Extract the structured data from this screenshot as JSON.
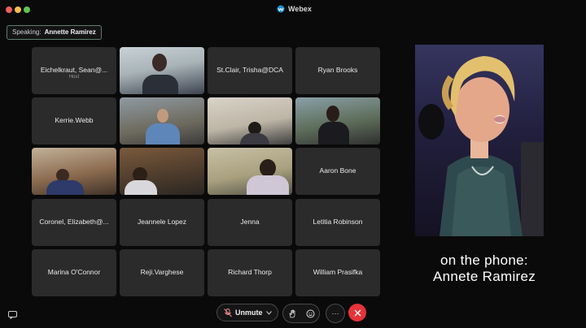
{
  "app": {
    "title": "Webex"
  },
  "speaking": {
    "label": "Speaking:",
    "name": "Annette Ramirez"
  },
  "grid": {
    "tiles": [
      {
        "name": "Eichelkraut, Sean@...",
        "subtitle": "Host"
      },
      {
        "name": "",
        "video": true
      },
      {
        "name": "St.Clair, Trisha@DCA"
      },
      {
        "name": "Ryan Brooks"
      },
      {
        "name": "Kerrie.Webb"
      },
      {
        "name": "",
        "video": true
      },
      {
        "name": "",
        "video": true
      },
      {
        "name": "",
        "video": true
      },
      {
        "name": "",
        "video": true
      },
      {
        "name": "",
        "video": true
      },
      {
        "name": "",
        "video": true
      },
      {
        "name": "Aaron Bone"
      },
      {
        "name": "Coronel, Elizabeth@..."
      },
      {
        "name": "Jeannele Lopez"
      },
      {
        "name": "Jenna"
      },
      {
        "name": "Letitia Robinson"
      },
      {
        "name": "Marina O'Connor"
      },
      {
        "name": "Reji.Varghese"
      },
      {
        "name": "Richard Thorp"
      },
      {
        "name": "William Prasifka"
      }
    ]
  },
  "caption": {
    "line1": "on the phone:",
    "line2": "Annete Ramirez"
  },
  "controls": {
    "unmute_label": "Unmute",
    "more_label": "···"
  },
  "colors": {
    "end_call": "#e5343a",
    "background": "#0a0a0a",
    "tile": "#2b2b2b"
  }
}
